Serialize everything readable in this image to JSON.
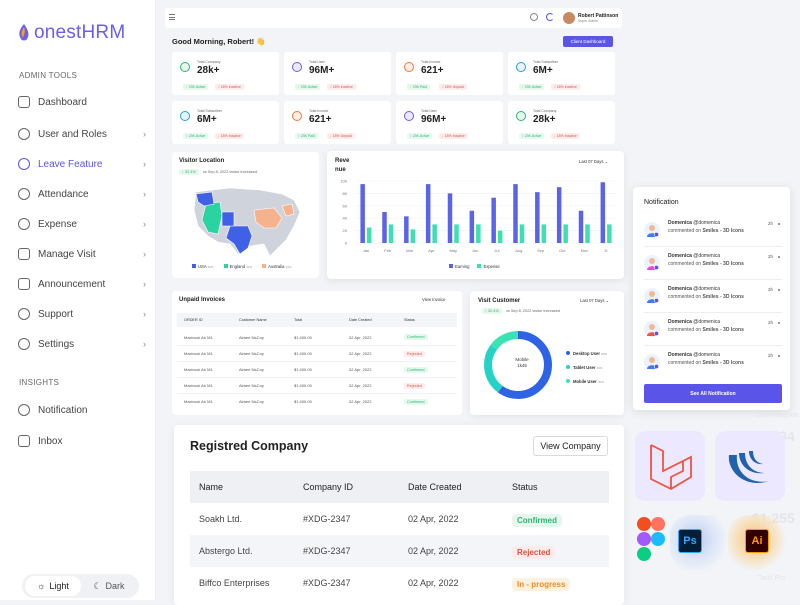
{
  "brand": {
    "name": "onest",
    "name_suffix": "HRM",
    "accent": "#5b54e8"
  },
  "sidebar": {
    "admin_label": "ADMIN TOOLS",
    "insights_label": "INSIGHTS",
    "items": [
      {
        "label": "Dashboard",
        "icon": "grid-icon"
      },
      {
        "label": "User and Roles",
        "icon": "user-icon"
      },
      {
        "label": "Leave Feature",
        "icon": "leaf-icon"
      },
      {
        "label": "Attendance",
        "icon": "clock-icon"
      },
      {
        "label": "Expense",
        "icon": "wallet-icon"
      },
      {
        "label": "Manage Visit",
        "icon": "map-icon"
      },
      {
        "label": "Announcement",
        "icon": "megaphone-icon"
      },
      {
        "label": "Support",
        "icon": "support-icon"
      },
      {
        "label": "Settings",
        "icon": "gear-icon"
      }
    ],
    "insight_items": [
      {
        "label": "Notification",
        "icon": "bell-icon"
      },
      {
        "label": "Inbox",
        "icon": "inbox-icon"
      }
    ],
    "theme": {
      "light": "Light",
      "dark": "Dark"
    }
  },
  "topbar": {
    "user_name": "Robert Pattinson",
    "user_role": "Super Admin"
  },
  "dashboard": {
    "greeting": "Good Morning, Robert! 👋",
    "client_button": "Client Dashboard",
    "stats": [
      {
        "label": "Total Company",
        "value": "28k+",
        "active": "23K Active",
        "inactive": "18% Inactive",
        "color": "#e7f6ee"
      },
      {
        "label": "Total User",
        "value": "96M+",
        "active": "23K Active",
        "inactive": "18% Inactive",
        "color": "#ece9ff"
      },
      {
        "label": "Total Invoice",
        "value": "621+",
        "active": "23K Paid",
        "inactive": "18% Unpaid",
        "color": "#fdeee6"
      },
      {
        "label": "Total Subscriber",
        "value": "6M+",
        "active": "23K Active",
        "inactive": "18% Inactive",
        "color": "#e6f4fb"
      },
      {
        "label": "Total Subscriber",
        "value": "6M+",
        "active": "23K Active",
        "inactive": "18% Inactive",
        "color": "#e6f4fb"
      },
      {
        "label": "Total Invoice",
        "value": "621+",
        "active": "23K Paid",
        "inactive": "18% Unpaid",
        "color": "#fdeee6"
      },
      {
        "label": "Total User",
        "value": "96M+",
        "active": "23K Active",
        "inactive": "18% Inactive",
        "color": "#ece9ff"
      },
      {
        "label": "Total Company",
        "value": "28k+",
        "active": "23K Active",
        "inactive": "18% Inactive",
        "color": "#e7f6ee"
      }
    ]
  },
  "visitor_location": {
    "title": "Visitor Location",
    "growth": "32.4%",
    "growth_note": "vs Sep 8, 2022 visitor Increased",
    "legend": [
      {
        "name": "USA",
        "pct": "52%",
        "color": "#4060e8"
      },
      {
        "name": "England",
        "pct": "32%",
        "color": "#2ad4a0"
      },
      {
        "name": "Australia",
        "pct": "16%",
        "color": "#f6b18d"
      }
    ]
  },
  "revenue": {
    "title": "Reve",
    "title_cont": "nue",
    "range": "Last 07 Days",
    "legend_earning": "Earning",
    "legend_expense": "Expense"
  },
  "chart_data": {
    "type": "bar",
    "categories": [
      "Jan",
      "Feb",
      "Mar",
      "Apr",
      "May",
      "Jun",
      "Jul",
      "Aug",
      "Sep",
      "Oct",
      "Nov",
      "D"
    ],
    "series": [
      {
        "name": "Earning",
        "values": [
          95,
          50,
          43,
          95,
          80,
          52,
          73,
          95,
          82,
          90,
          52,
          98
        ],
        "color": "#5b63e8"
      },
      {
        "name": "Expense",
        "values": [
          25,
          30,
          22,
          30,
          30,
          30,
          20,
          30,
          30,
          30,
          30,
          30
        ],
        "color": "#3de0b0"
      }
    ],
    "ylim": [
      0,
      100
    ],
    "yticks": [
      "100",
      "80",
      "60",
      "40",
      "20",
      "0"
    ],
    "legend": "bottom-center",
    "grid": true
  },
  "invoices": {
    "title": "Unpaid Invoices",
    "view_label": "View Invoice",
    "headers": [
      "ORDER ID",
      "Customer Name",
      "Total",
      "Date Created",
      "Status"
    ],
    "rows": [
      {
        "product": "Macbook Air M1",
        "customer": "Aimee McCoy",
        "total": "$1,400.00",
        "date": "02 Apr, 2022",
        "status": "Confirmed",
        "color": "#2bb673",
        "bg": "#e6f7ee"
      },
      {
        "product": "Macbook Air M1",
        "customer": "Aimee McCoy",
        "total": "$1,400.00",
        "date": "02 Apr, 2022",
        "status": "Rejected",
        "color": "#e0533d",
        "bg": "#fdeceb"
      },
      {
        "product": "Macbook Air M1",
        "customer": "Aimee McCoy",
        "total": "$1,400.00",
        "date": "02 Apr, 2022",
        "status": "Confirmed",
        "color": "#2bb673",
        "bg": "#e6f7ee"
      },
      {
        "product": "Macbook Air M1",
        "customer": "Aimee McCoy",
        "total": "$1,400.00",
        "date": "02 Apr, 2022",
        "status": "Rejected",
        "color": "#e0533d",
        "bg": "#fdeceb"
      },
      {
        "product": "Macbook Air M1",
        "customer": "Aimee McCoy",
        "total": "$1,400.00",
        "date": "02 Apr, 2022",
        "status": "Confirmed",
        "color": "#2bb673",
        "bg": "#e6f7ee"
      }
    ]
  },
  "visit_customer": {
    "title": "Visit Customer",
    "range": "Last 07 Days",
    "growth": "32.4%",
    "growth_note": "vs Sep 8, 2022 visitor Increased",
    "center_label": "Mobile",
    "center_value": "1k45",
    "legend": [
      {
        "name": "Desktop User",
        "pct": "80%",
        "color": "#2f63e6"
      },
      {
        "name": "Tablet User",
        "pct": "40%",
        "color": "#23d3c6"
      },
      {
        "name": "Mobile User",
        "pct": "30%",
        "color": "#39e3b4"
      }
    ],
    "segments": [
      0.6,
      0.25,
      0.15
    ]
  },
  "notifications": {
    "title": "Notification",
    "button": "See All Notification",
    "items": [
      {
        "name": "Domenica",
        "handle": "@domenica",
        "text": "commented on",
        "target": "Smiles - 3D Icons",
        "time": "2h"
      },
      {
        "name": "Domenica",
        "handle": "@domenica",
        "text": "commented on",
        "target": "Smiles - 3D Icons",
        "time": "2h"
      },
      {
        "name": "Domenica",
        "handle": "@domenica",
        "text": "commented on",
        "target": "Smiles - 3D Icons",
        "time": "2h"
      },
      {
        "name": "Domenica",
        "handle": "@domenica",
        "text": "commented on",
        "target": "Smiles - 3D Icons",
        "time": "2h"
      },
      {
        "name": "Domenica",
        "handle": "@domenica",
        "text": "commented on",
        "target": "Smiles - 3D Icons",
        "time": "2h"
      }
    ]
  },
  "registered": {
    "title": "Registred Company",
    "view_button": "View Company",
    "headers": [
      "Name",
      "Company ID",
      "Date Created",
      "Status"
    ],
    "rows": [
      {
        "name": "Soakh Ltd.",
        "id": "#XDG-2347",
        "date": "02 Apr, 2022",
        "status": "Confirmed",
        "color": "#2bb673",
        "bg": "#e6f7ee"
      },
      {
        "name": "Abstergo Ltd.",
        "id": "#XDG-2347",
        "date": "02 Apr, 2022",
        "status": "Rejected",
        "color": "#e0533d",
        "bg": "#fdeceb"
      },
      {
        "name": "Biffco Enterprises",
        "id": "#XDG-2347",
        "date": "02 Apr, 2022",
        "status": "In - progress",
        "color": "#f08c1e",
        "bg": "#fff1e0"
      }
    ]
  },
  "decor": {
    "ps": "Ps",
    "ai": "Ai",
    "faded_value_1": "$62,94",
    "faded_value_2": "$1,255",
    "faded_label": "Total Revenue",
    "faded_label_2": "Total Pro"
  }
}
